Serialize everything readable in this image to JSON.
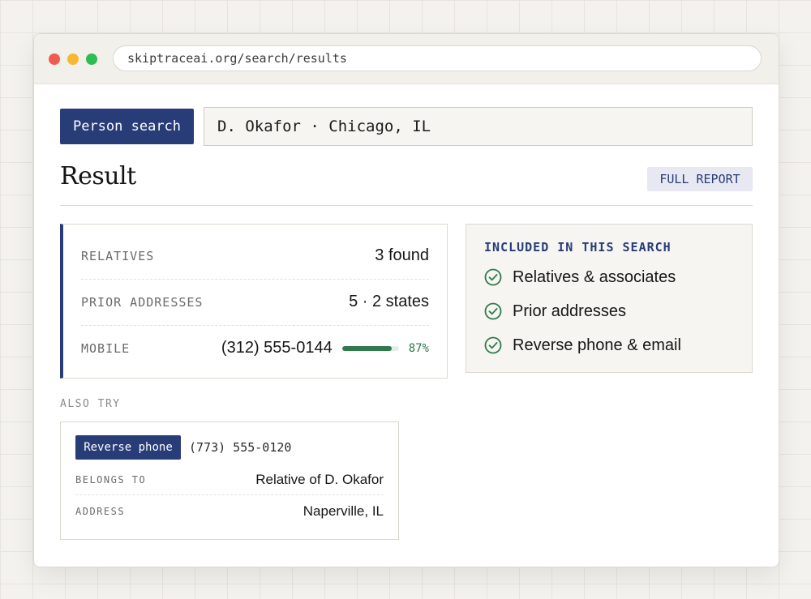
{
  "browser": {
    "url": "skiptraceai.org/search/results"
  },
  "search": {
    "mode_label": "Person search",
    "query": "D. Okafor · Chicago, IL"
  },
  "result": {
    "title": "Result",
    "full_report_label": "FULL REPORT",
    "stats": [
      {
        "label": "RELATIVES",
        "value": "3 found"
      },
      {
        "label": "PRIOR ADDRESSES",
        "value": "5 · 2 states"
      },
      {
        "label": "MOBILE",
        "value": "(312) 555-0144",
        "confidence": 0.87,
        "confidence_label": "87%"
      }
    ]
  },
  "included": {
    "title": "INCLUDED IN THIS SEARCH",
    "items": [
      {
        "label": "Relatives & associates",
        "icon": "check-circle-icon"
      },
      {
        "label": "Prior addresses",
        "icon": "check-circle-icon"
      },
      {
        "label": "Reverse phone & email",
        "icon": "check-circle-icon"
      }
    ]
  },
  "also_try": {
    "heading": "ALSO TRY",
    "button_label": "Reverse phone",
    "phone": "(773) 555-0120",
    "rows": [
      {
        "label": "BELONGS TO",
        "value": "Relative of D. Okafor"
      },
      {
        "label": "ADDRESS",
        "value": "Naperville, IL"
      }
    ]
  },
  "colors": {
    "accent": "#283c78",
    "success": "#2f7a4c",
    "window_close": "#f05a4f",
    "window_minimize": "#f6b82e",
    "window_maximize": "#2dbd52"
  }
}
